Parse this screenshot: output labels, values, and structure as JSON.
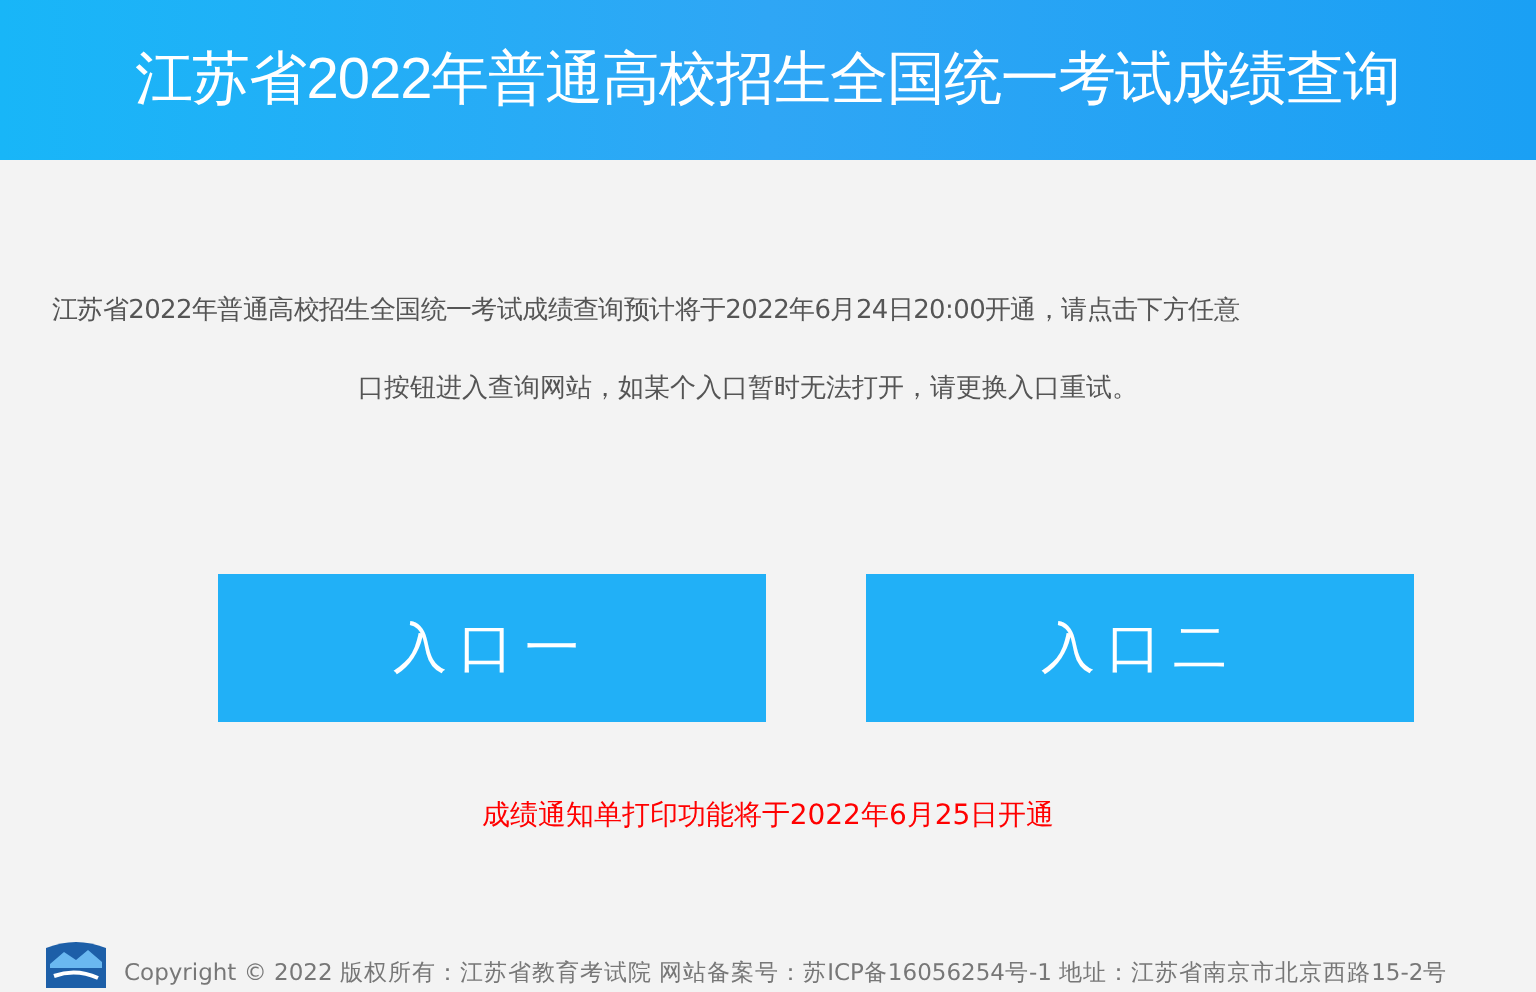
{
  "header": {
    "title": "江苏省2022年普通高校招生全国统一考试成绩查询"
  },
  "notice": {
    "lines": [
      "江苏省2022年普通高校招生全国统一考试成绩查询预计将于2022年6月24日20:00开通，请点击下方任意",
      "口按钮进入查询网站，如某个入口暂时无法打开，请更换入口重试。"
    ]
  },
  "entry_buttons": [
    "入口一",
    "入口二"
  ],
  "print_notice": "成绩通知单打印功能将于2022年6月25日开通",
  "footer": {
    "text": "Copyright © 2022 版权所有：江苏省教育考试院  网站备案号：苏ICP备16056254号-1  地址：江苏省南京市北京西路15-2号"
  }
}
